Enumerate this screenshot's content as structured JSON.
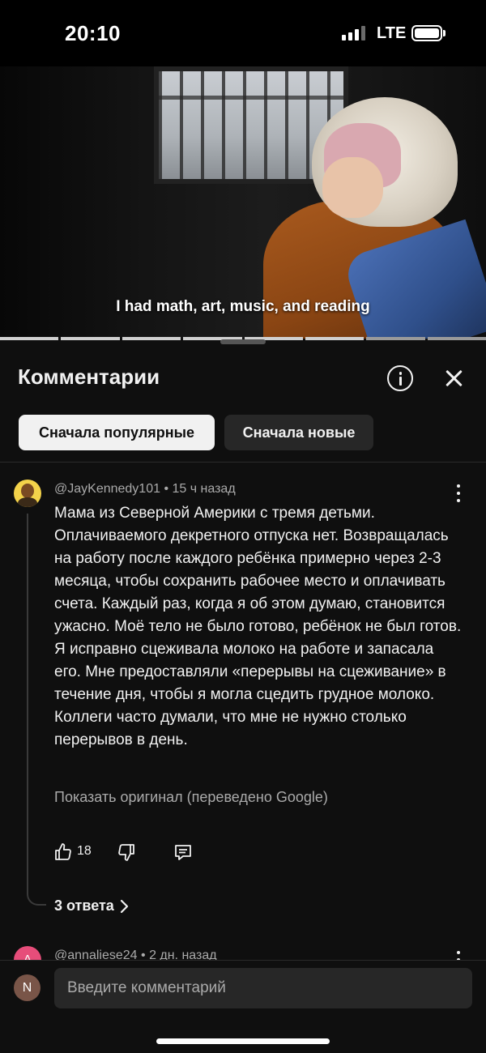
{
  "status_bar": {
    "time": "20:10",
    "network": "LTE"
  },
  "video": {
    "caption": "I had math, art, music, and reading"
  },
  "comments_sheet": {
    "title": "Комментарии",
    "sort_chips": [
      "Сначала популярные",
      "Сначала новые"
    ],
    "active_sort": "Сначала популярные"
  },
  "comment": {
    "author": "@JayKennedy101",
    "separator": "•",
    "time": "15 ч назад",
    "text": "Мама из Северной Америки с тремя детьми. Оплачиваемого декретного отпуска нет. Возвращалась на работу после каждого ребёнка примерно через 2-3 месяца, чтобы сохранить рабочее место и оплачивать счета. Каждый раз, когда я об этом думаю, становится ужасно. Моё тело не было готово, ребёнок не был готов. Я исправно сцеживала молоко на работе и запасала его. Мне предоставляли «перерывы на сцеживание» в течение дня, чтобы я могла сцедить грудное молоко. Коллеги часто думали, что мне не нужно столько перерывов в день.",
    "show_original": "Показать оригинал (переведено Google)",
    "likes": "18",
    "replies": "3 ответа"
  },
  "next_comment": {
    "author": "@annaliese24",
    "separator": "•",
    "time": "2 дн. назад",
    "avatar_letter": "A"
  },
  "input": {
    "placeholder": "Введите комментарий",
    "user_initial": "N"
  },
  "colors": {
    "background": "#0f0f0f",
    "chip_active": "#f1f1f1",
    "chip_inactive": "#272727",
    "secondary_text": "#aaaaaa",
    "avatar_next": "#e64d7a",
    "avatar_user": "#795548"
  },
  "icons": [
    "info-icon",
    "close-icon",
    "more-vert-icon",
    "thumb-up-icon",
    "thumb-down-icon",
    "reply-icon",
    "chevron-right-icon"
  ]
}
